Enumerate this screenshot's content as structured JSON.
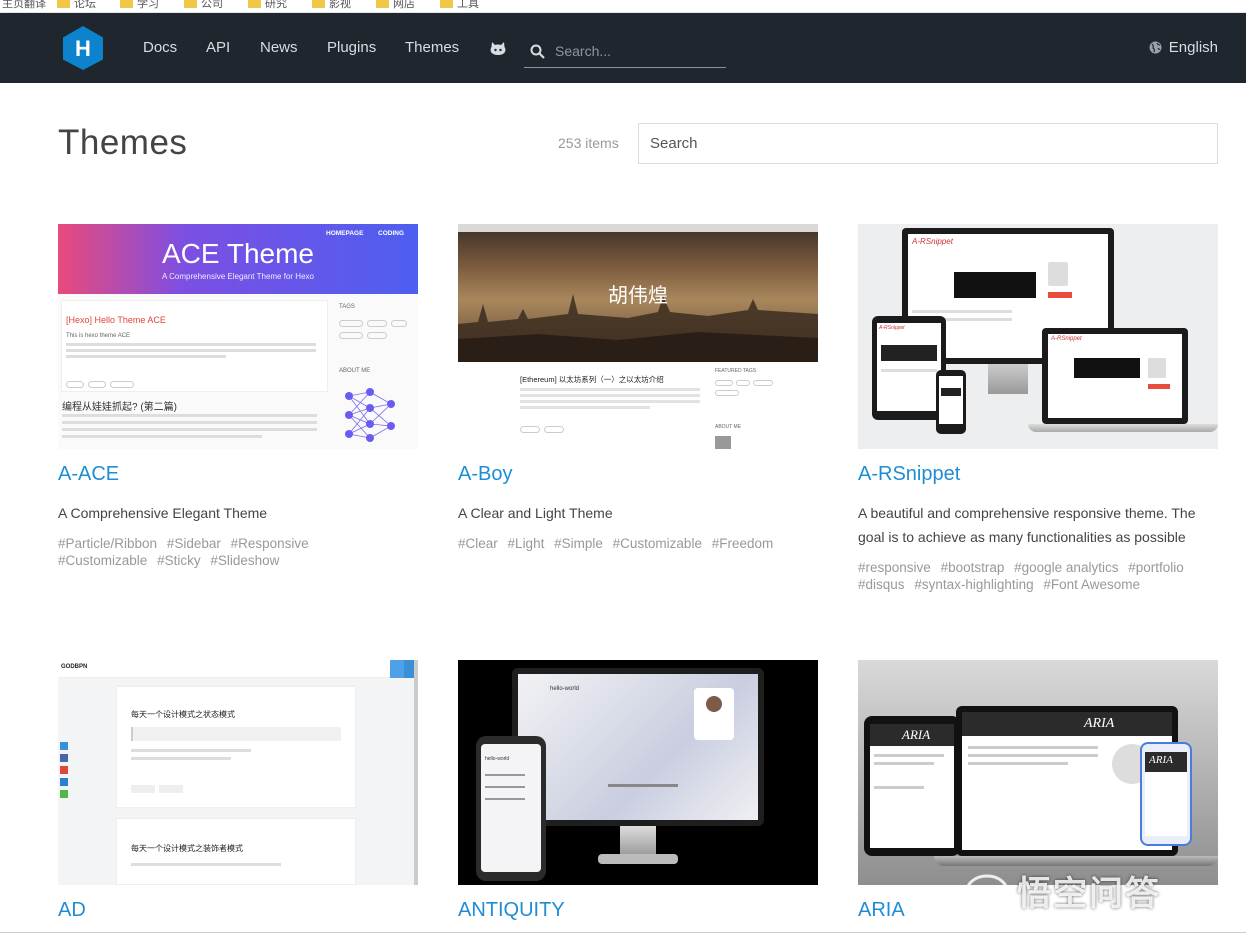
{
  "bookmarks": [
    "主页翻译",
    "论坛",
    "学习",
    "公司",
    "研究",
    "影视",
    "网店",
    "工具"
  ],
  "nav": {
    "links": [
      "Docs",
      "API",
      "News",
      "Plugins",
      "Themes"
    ],
    "search_placeholder": "Search...",
    "language": "English",
    "logo_letter": "H",
    "colors": {
      "bar": "#1f262e",
      "logo": "#0e83cd"
    }
  },
  "header": {
    "title": "Themes",
    "count": "253 items",
    "search_placeholder": "Search"
  },
  "themes": [
    {
      "name": "A-ACE",
      "description": "A Comprehensive Elegant Theme",
      "tags": [
        "#Particle/Ribbon",
        "#Sidebar",
        "#Responsive",
        "#Customizable",
        "#Sticky",
        "#Slideshow"
      ],
      "thumb": {
        "title": "ACE Theme",
        "subtitle": "A Comprehensive Elegant Theme for Hexo",
        "menu": [
          "HOMEPAGE",
          "CODING"
        ],
        "post_title": "[Hexo] Hello Theme ACE",
        "post_text": "This is hexo theme ACE",
        "post2_title": "编程从娃娃抓起? (第二篇)",
        "side_tags": "TAGS",
        "side_about": "ABOUT ME"
      }
    },
    {
      "name": "A-Boy",
      "description": "A Clear and Light Theme",
      "tags": [
        "#Clear",
        "#Light",
        "#Simple",
        "#Customizable",
        "#Freedom"
      ],
      "thumb": {
        "hero_title": "胡伟煌",
        "post_title": "[Ethereum] 以太坊系列（一）之以太坊介绍",
        "side_title": "FEATURED TAGS",
        "side_about": "ABOUT ME"
      }
    },
    {
      "name": "A-RSnippet",
      "description": "A beautiful and comprehensive responsive theme. The goal is to achieve as many functionalities as possible",
      "tags": [
        "#responsive",
        "#bootstrap",
        "#google analytics",
        "#portfolio",
        "#disqus",
        "#syntax-highlighting",
        "#Font Awesome"
      ],
      "thumb": {
        "brand": "A-RSnippet"
      }
    },
    {
      "name": "AD",
      "description": "",
      "tags": [],
      "thumb": {
        "brand": "GODBPN",
        "post1": "每天一个设计模式之状态模式",
        "post2": "每天一个设计模式之装饰者模式"
      }
    },
    {
      "name": "ANTIQUITY",
      "description": "",
      "tags": [],
      "thumb": {
        "post": "hello-world"
      }
    },
    {
      "name": "ARIA",
      "description": "",
      "tags": [],
      "thumb": {
        "brand": "ARIA"
      }
    }
  ],
  "watermark": "悟空问答"
}
